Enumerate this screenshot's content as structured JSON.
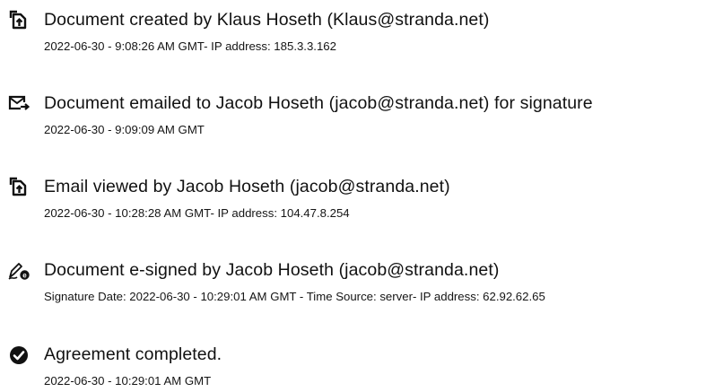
{
  "events": [
    {
      "icon": "document-upload-icon",
      "title": "Document created by Klaus Hoseth (Klaus@stranda.net)",
      "meta": "2022-06-30 - 9:08:26 AM GMT- IP address: 185.3.3.162"
    },
    {
      "icon": "email-sent-icon",
      "title": "Document emailed to Jacob Hoseth (jacob@stranda.net) for signature",
      "meta": "2022-06-30 - 9:09:09 AM GMT"
    },
    {
      "icon": "document-upload-icon",
      "title": "Email viewed by Jacob Hoseth (jacob@stranda.net)",
      "meta": "2022-06-30 - 10:28:28 AM GMT- IP address: 104.47.8.254"
    },
    {
      "icon": "signature-pen-icon",
      "title": "Document e-signed by Jacob Hoseth (jacob@stranda.net)",
      "meta": "Signature Date: 2022-06-30 - 10:29:01 AM GMT - Time Source: server- IP address: 62.92.62.65"
    },
    {
      "icon": "check-circle-icon",
      "title": "Agreement completed.",
      "meta": "2022-06-30 - 10:29:01 AM GMT"
    }
  ]
}
